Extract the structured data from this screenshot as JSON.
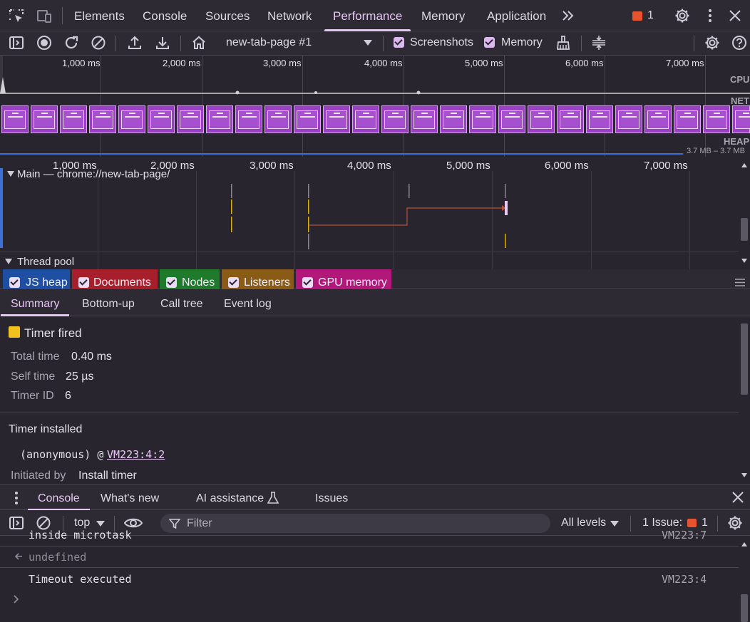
{
  "devtools_tabs": {
    "elements": "Elements",
    "console": "Console",
    "sources": "Sources",
    "network": "Network",
    "performance": "Performance",
    "memory": "Memory",
    "application": "Application"
  },
  "issues_count": "1",
  "perf_toolbar": {
    "recording_target": "new-tab-page #1",
    "screenshots_label": "Screenshots",
    "memory_label": "Memory",
    "screenshots_checked": true,
    "memory_checked": true
  },
  "overview": {
    "ticks": [
      "1,000 ms",
      "2,000 ms",
      "3,000 ms",
      "4,000 ms",
      "5,000 ms",
      "6,000 ms",
      "7,000 ms"
    ],
    "cpu_label": "CPU",
    "net_label": "NET",
    "heap_label": "HEAP",
    "heap_range": "3.7 MB – 3.7 MB"
  },
  "flamechart": {
    "ticks": [
      "1,000 ms",
      "2,000 ms",
      "3,000 ms",
      "4,000 ms",
      "5,000 ms",
      "6,000 ms",
      "7,000 ms"
    ],
    "main_track": "Main — chrome://new-tab-page/",
    "thread_pool": "Thread pool"
  },
  "memory_legend": [
    {
      "label": "JS heap",
      "color": "#1f4fa3",
      "checked": true
    },
    {
      "label": "Documents",
      "color": "#a71f2a",
      "checked": true
    },
    {
      "label": "Nodes",
      "color": "#1f7a2b",
      "checked": true
    },
    {
      "label": "Listeners",
      "color": "#8a5a17",
      "checked": true
    },
    {
      "label": "GPU memory",
      "color": "#b2187a",
      "checked": true
    }
  ],
  "detail_tabs": {
    "summary": "Summary",
    "bottom_up": "Bottom-up",
    "call_tree": "Call tree",
    "event_log": "Event log"
  },
  "summary": {
    "event_title": "Timer fired",
    "event_color": "#f1c21b",
    "total_time_label": "Total time",
    "total_time": "0.40 ms",
    "self_time_label": "Self time",
    "self_time": "25 µs",
    "timer_id_label": "Timer ID",
    "timer_id": "6",
    "timer_installed": "Timer installed",
    "stack_fn": "(anonymous) @",
    "stack_link": "VM223:4:2",
    "initiated_by_label": "Initiated by",
    "initiated_by": "Install timer"
  },
  "drawer_tabs": {
    "console": "Console",
    "whats_new": "What's new",
    "ai_assistance": "AI assistance",
    "issues": "Issues"
  },
  "console_toolbar": {
    "context": "top",
    "filter_placeholder": "Filter",
    "levels": "All levels",
    "issues_label": "1 Issue:",
    "issues_count": "1"
  },
  "console_messages": [
    {
      "text": "inside microtask",
      "source": "VM223:7"
    },
    {
      "text": "undefined",
      "source": ""
    },
    {
      "text": "Timeout executed",
      "source": "VM223:4"
    }
  ],
  "colors": {
    "accent": "#e7c6f5",
    "background": "#28252e",
    "frame_purple": "#9b3fc4",
    "issue_badge": "#e8532f"
  }
}
